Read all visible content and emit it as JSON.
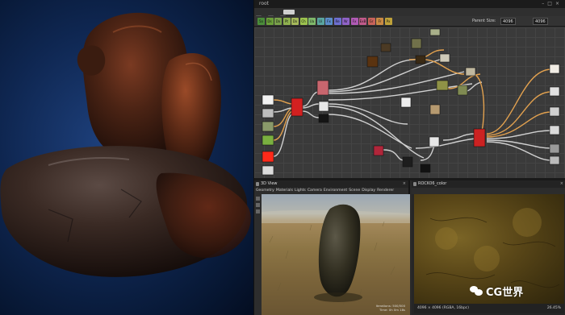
{
  "app": {
    "graph_title": "root",
    "toolbar_labels": [
      "5o",
      "Ds",
      "Dx",
      "Pt",
      "Dx",
      "Ch",
      "Ua",
      "Ui",
      "Fx",
      "Re",
      "Nr",
      "Fx",
      "ExB",
      "Gr",
      "Fr",
      "Px"
    ],
    "toolbar_colors": [
      "#4a8c3a",
      "#6b9f3a",
      "#79a04a",
      "#8fb04f",
      "#a5b85a",
      "#9bc24e",
      "#7fb86a",
      "#5aa5a0",
      "#5b8dc9",
      "#6d6fd0",
      "#8f62c7",
      "#b05ab5",
      "#c05a8a",
      "#c7635a",
      "#c98a44",
      "#bfa23a"
    ],
    "parent_size_label": "Parent Size:",
    "parent_size_value": "4096",
    "size_value": "4096"
  },
  "view3d": {
    "title": "3D View",
    "menu": [
      "Geometry",
      "Materials",
      "Lights",
      "Camera",
      "Environment",
      "Scene",
      "Display",
      "Renderer"
    ],
    "stats_line1": "Iterations: 500/500",
    "stats_line2": "Time: 0h 0m 18s"
  },
  "view2d": {
    "title": "ROCK06_color",
    "status": "4096 × 4096 (RGBA, 16bpc)",
    "zoom": "26.45%"
  },
  "watermark": {
    "text": "CG世界"
  }
}
